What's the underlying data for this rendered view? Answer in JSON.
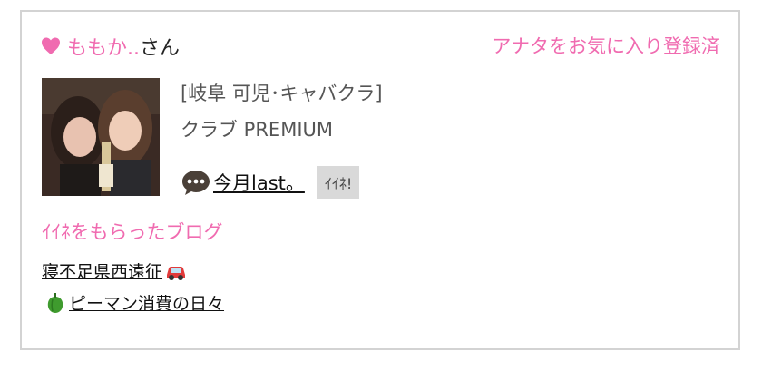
{
  "user": {
    "name": "ももか..",
    "suffix": "さん",
    "favorite_status": "アナタをお気に入り登録済"
  },
  "shop": {
    "location": "[岐阜 可児･キャバクラ]",
    "name": "クラブ PREMIUM"
  },
  "latest_post": {
    "title": "今月last。",
    "like_button": "ｲｲﾈ!"
  },
  "blog_section": {
    "heading": "ｲｲﾈをもらったブログ",
    "items": [
      {
        "title": "寝不足県西遠征",
        "icon": "car-icon"
      },
      {
        "title": "ピーマン消費の日々",
        "icon": "green-pepper-icon"
      }
    ]
  },
  "colors": {
    "accent": "#f06bb0",
    "border": "#d3d3d3",
    "button_bg": "#d9d9d9"
  }
}
